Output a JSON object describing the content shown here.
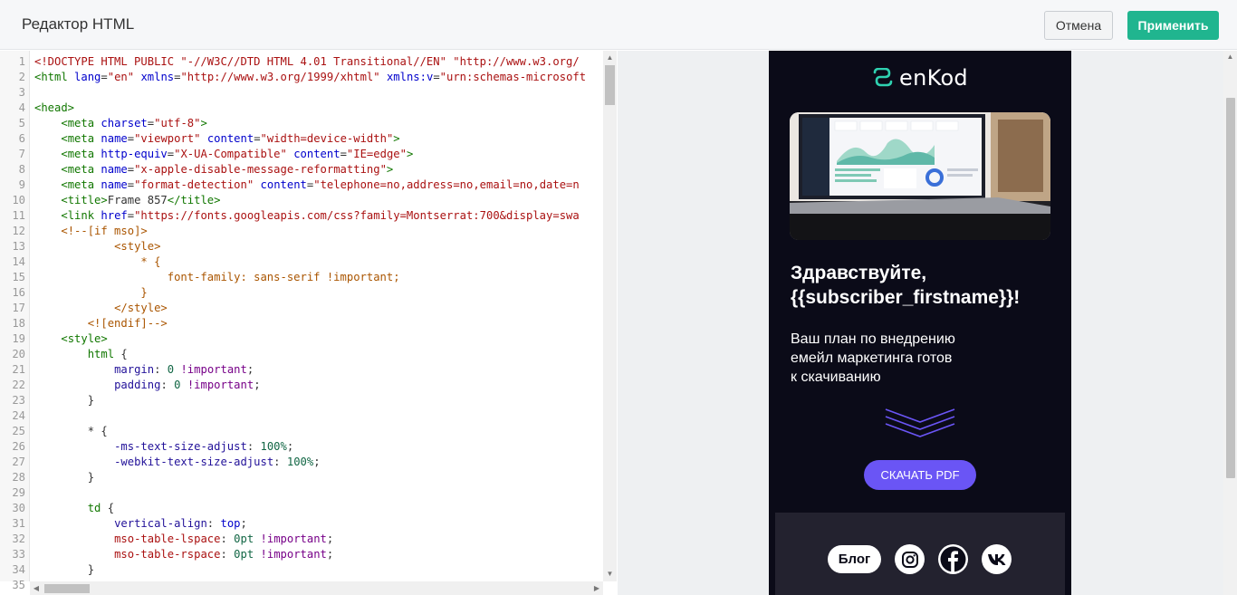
{
  "header": {
    "title": "Редактор HTML",
    "cancel_label": "Отмена",
    "apply_label": "Применить"
  },
  "editor": {
    "line_numbers": [
      "1",
      "2",
      "3",
      "4",
      "5",
      "6",
      "7",
      "8",
      "9",
      "10",
      "11",
      "12",
      "13",
      "14",
      "15",
      "16",
      "17",
      "18",
      "19",
      "20",
      "21",
      "22",
      "23",
      "24",
      "25",
      "26",
      "27",
      "28",
      "29",
      "30",
      "31",
      "32",
      "33",
      "34",
      "35"
    ],
    "lines": [
      [
        [
          "<!DOCTYPE HTML PUBLIC \"-//W3C//DTD HTML 4.01 Transitional//EN\" \"http://www.w3.org/",
          "ph"
        ]
      ],
      [
        [
          "<html",
          "tg"
        ],
        [
          " ",
          ""
        ],
        [
          "lang",
          "at"
        ],
        [
          "=",
          ""
        ],
        [
          "\"en\"",
          "st"
        ],
        [
          " ",
          ""
        ],
        [
          "xmlns",
          "at"
        ],
        [
          "=",
          ""
        ],
        [
          "\"http://www.w3.org/1999/xhtml\"",
          "st"
        ],
        [
          " ",
          ""
        ],
        [
          "xmlns:v",
          "at"
        ],
        [
          "=",
          ""
        ],
        [
          "\"urn:schemas-microsoft",
          "st"
        ]
      ],
      [],
      [
        [
          "<head>",
          "tg"
        ]
      ],
      [
        [
          "    ",
          ""
        ],
        [
          "<meta",
          "tg"
        ],
        [
          " ",
          ""
        ],
        [
          "charset",
          "at"
        ],
        [
          "=",
          ""
        ],
        [
          "\"utf-8\"",
          "st"
        ],
        [
          ">",
          "tg"
        ]
      ],
      [
        [
          "    ",
          ""
        ],
        [
          "<meta",
          "tg"
        ],
        [
          " ",
          ""
        ],
        [
          "name",
          "at"
        ],
        [
          "=",
          ""
        ],
        [
          "\"viewport\"",
          "st"
        ],
        [
          " ",
          ""
        ],
        [
          "content",
          "at"
        ],
        [
          "=",
          ""
        ],
        [
          "\"width=device-width\"",
          "st"
        ],
        [
          ">",
          "tg"
        ]
      ],
      [
        [
          "    ",
          ""
        ],
        [
          "<meta",
          "tg"
        ],
        [
          " ",
          ""
        ],
        [
          "http-equiv",
          "at"
        ],
        [
          "=",
          ""
        ],
        [
          "\"X-UA-Compatible\"",
          "st"
        ],
        [
          " ",
          ""
        ],
        [
          "content",
          "at"
        ],
        [
          "=",
          ""
        ],
        [
          "\"IE=edge\"",
          "st"
        ],
        [
          ">",
          "tg"
        ]
      ],
      [
        [
          "    ",
          ""
        ],
        [
          "<meta",
          "tg"
        ],
        [
          " ",
          ""
        ],
        [
          "name",
          "at"
        ],
        [
          "=",
          ""
        ],
        [
          "\"x-apple-disable-message-reformatting\"",
          "st"
        ],
        [
          ">",
          "tg"
        ]
      ],
      [
        [
          "    ",
          ""
        ],
        [
          "<meta",
          "tg"
        ],
        [
          " ",
          ""
        ],
        [
          "name",
          "at"
        ],
        [
          "=",
          ""
        ],
        [
          "\"format-detection\"",
          "st"
        ],
        [
          " ",
          ""
        ],
        [
          "content",
          "at"
        ],
        [
          "=",
          ""
        ],
        [
          "\"telephone=no,address=no,email=no,date=n",
          "st"
        ]
      ],
      [
        [
          "    ",
          ""
        ],
        [
          "<title>",
          "tg"
        ],
        [
          "Frame 857",
          ""
        ],
        [
          "</title>",
          "tg"
        ]
      ],
      [
        [
          "    ",
          ""
        ],
        [
          "<link",
          "tg"
        ],
        [
          " ",
          ""
        ],
        [
          "href",
          "at"
        ],
        [
          "=",
          ""
        ],
        [
          "\"https://fonts.googleapis.com/css?family=Montserrat:700&display=swa",
          "st"
        ]
      ],
      [
        [
          "    ",
          ""
        ],
        [
          "<!--[if mso]>",
          "cm"
        ]
      ],
      [
        [
          "            ",
          ""
        ],
        [
          "<style>",
          "cm"
        ]
      ],
      [
        [
          "                ",
          ""
        ],
        [
          "* {",
          "cm"
        ]
      ],
      [
        [
          "                    ",
          ""
        ],
        [
          "font-family: sans-serif !important;",
          "cm"
        ]
      ],
      [
        [
          "                ",
          ""
        ],
        [
          "}",
          "cm"
        ]
      ],
      [
        [
          "            ",
          ""
        ],
        [
          "</style>",
          "cm"
        ]
      ],
      [
        [
          "        ",
          ""
        ],
        [
          "<![endif]-->",
          "cm"
        ]
      ],
      [
        [
          "    ",
          ""
        ],
        [
          "<style>",
          "tg"
        ]
      ],
      [
        [
          "        ",
          ""
        ],
        [
          "html",
          "tg"
        ],
        [
          " {",
          ""
        ]
      ],
      [
        [
          "            ",
          ""
        ],
        [
          "margin",
          "pr"
        ],
        [
          ": ",
          ""
        ],
        [
          "0",
          "nm"
        ],
        [
          " ",
          ""
        ],
        [
          "!important",
          "kw"
        ],
        [
          ";",
          ""
        ]
      ],
      [
        [
          "            ",
          ""
        ],
        [
          "padding",
          "pr"
        ],
        [
          ": ",
          ""
        ],
        [
          "0",
          "nm"
        ],
        [
          " ",
          ""
        ],
        [
          "!important",
          "kw"
        ],
        [
          ";",
          ""
        ]
      ],
      [
        [
          "        }",
          ""
        ]
      ],
      [],
      [
        [
          "        * {",
          ""
        ]
      ],
      [
        [
          "            ",
          ""
        ],
        [
          "-ms-text-size-adjust",
          "pr"
        ],
        [
          ": ",
          ""
        ],
        [
          "100%",
          "nm"
        ],
        [
          ";",
          ""
        ]
      ],
      [
        [
          "            ",
          ""
        ],
        [
          "-webkit-text-size-adjust",
          "pr"
        ],
        [
          ": ",
          ""
        ],
        [
          "100%",
          "nm"
        ],
        [
          ";",
          ""
        ]
      ],
      [
        [
          "        }",
          ""
        ]
      ],
      [],
      [
        [
          "        ",
          ""
        ],
        [
          "td",
          "tg"
        ],
        [
          " {",
          ""
        ]
      ],
      [
        [
          "            ",
          ""
        ],
        [
          "vertical-align",
          "pr"
        ],
        [
          ": ",
          ""
        ],
        [
          "top",
          "at"
        ],
        [
          ";",
          ""
        ]
      ],
      [
        [
          "            ",
          ""
        ],
        [
          "mso-table-lspace",
          "ph"
        ],
        [
          ": ",
          ""
        ],
        [
          "0pt",
          "nm"
        ],
        [
          " ",
          ""
        ],
        [
          "!important",
          "kw"
        ],
        [
          ";",
          ""
        ]
      ],
      [
        [
          "            ",
          ""
        ],
        [
          "mso-table-rspace",
          "ph"
        ],
        [
          ": ",
          ""
        ],
        [
          "0pt",
          "nm"
        ],
        [
          " ",
          ""
        ],
        [
          "!important",
          "kw"
        ],
        [
          ";",
          ""
        ]
      ],
      [
        [
          "        }",
          ""
        ]
      ],
      []
    ]
  },
  "email_preview": {
    "logo_text": "enKod",
    "greeting_line1": "Здравствуйте,",
    "greeting_line2": "{{subscriber_firstname}}!",
    "subtitle_line1": "Ваш план по внедрению",
    "subtitle_line2": "емейл маркетинга готов",
    "subtitle_line3": "к скачиванию",
    "cta_label": "СКАЧАТЬ PDF",
    "blog_label": "Блог",
    "accent_color": "#6a55f5",
    "brand_color": "#2fd1b0",
    "background_color": "#0b0b18",
    "footer_color": "#23222f",
    "social_icons": [
      "instagram-icon",
      "facebook-icon",
      "vk-icon"
    ]
  }
}
